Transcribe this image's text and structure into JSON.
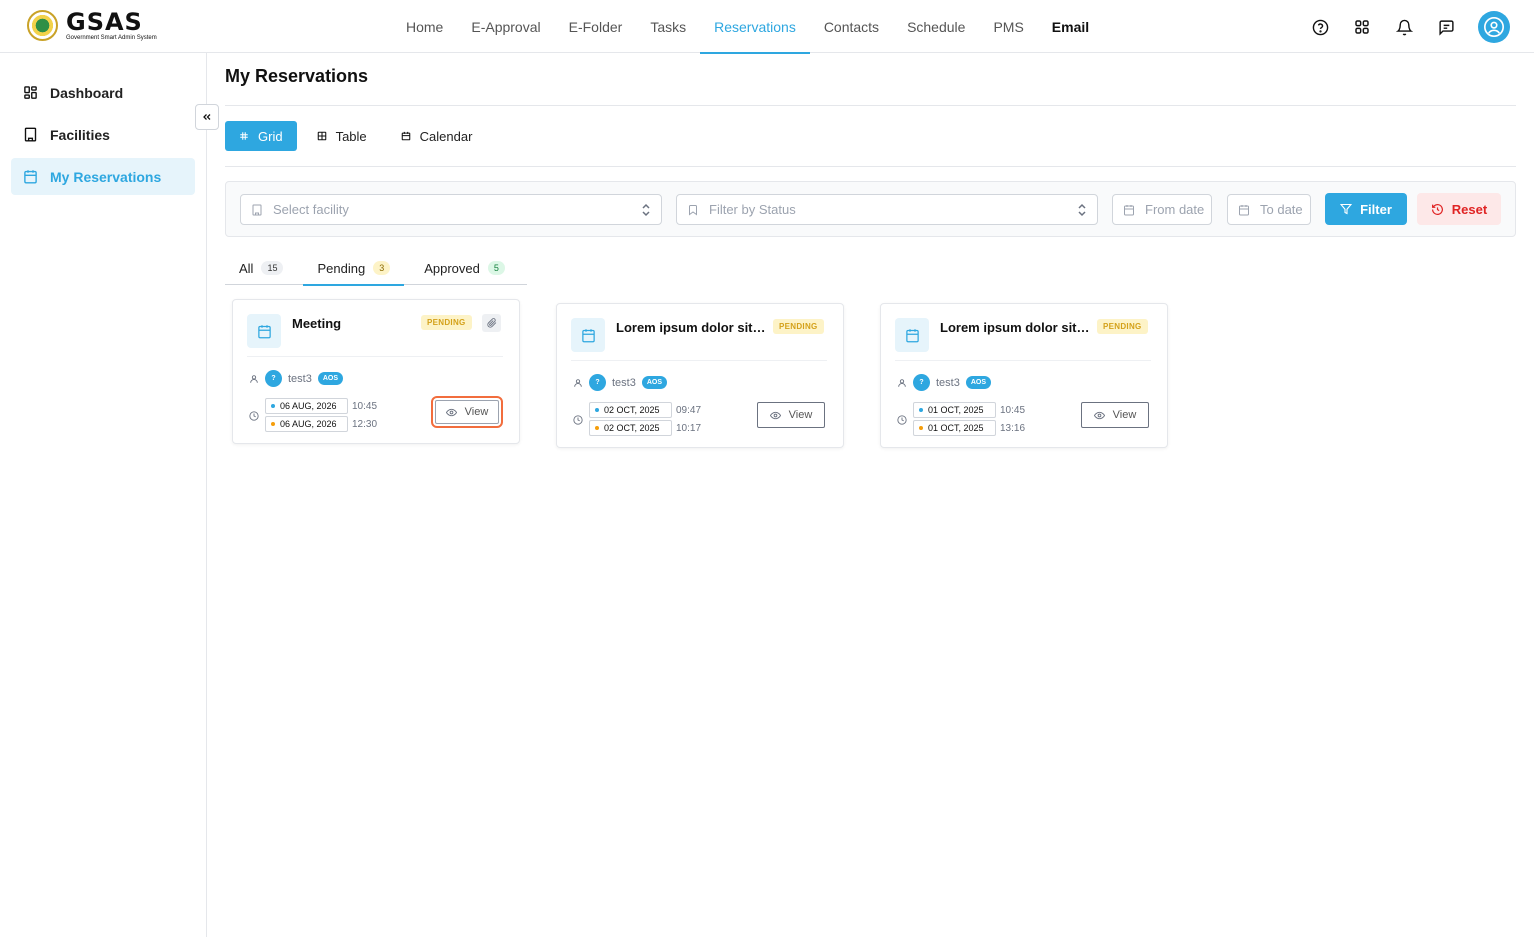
{
  "brand": {
    "name": "GSAS",
    "subtitle": "Government Smart Admin System"
  },
  "nav": {
    "items": [
      {
        "label": "Home"
      },
      {
        "label": "E-Approval"
      },
      {
        "label": "E-Folder"
      },
      {
        "label": "Tasks"
      },
      {
        "label": "Reservations",
        "active": true
      },
      {
        "label": "Contacts"
      },
      {
        "label": "Schedule"
      },
      {
        "label": "PMS"
      },
      {
        "label": "Email"
      }
    ]
  },
  "top_icons": [
    "help-circle-icon",
    "apps-grid-icon",
    "bell-icon",
    "message-icon",
    "user-avatar-icon"
  ],
  "sidebar": {
    "items": [
      {
        "label": "Dashboard",
        "icon": "dashboard-icon"
      },
      {
        "label": "Facilities",
        "icon": "building-icon"
      },
      {
        "label": "My Reservations",
        "icon": "calendar-icon",
        "active": true
      }
    ]
  },
  "page": {
    "title": "My Reservations",
    "view_tabs": [
      {
        "label": "Grid",
        "active": true
      },
      {
        "label": "Table"
      },
      {
        "label": "Calendar"
      }
    ]
  },
  "filters": {
    "facility_placeholder": "Select facility",
    "status_placeholder": "Filter by Status",
    "from_placeholder": "From date",
    "to_placeholder": "To date",
    "filter_label": "Filter",
    "reset_label": "Reset"
  },
  "status_tabs": [
    {
      "label": "All",
      "count": "15"
    },
    {
      "label": "Pending",
      "count": "3",
      "active": true
    },
    {
      "label": "Approved",
      "count": "5"
    }
  ],
  "cards": [
    {
      "title": "Meeting",
      "status": "PENDING",
      "has_attachment": true,
      "user_initial": "?",
      "user": "test3",
      "org": "AOS",
      "start_date": "06 AUG, 2026",
      "start_time": "10:45",
      "end_date": "06 AUG, 2026",
      "end_time": "12:30",
      "view_label": "View"
    },
    {
      "title": "Lorem ipsum dolor sit ...",
      "status": "PENDING",
      "user_initial": "?",
      "user": "test3",
      "org": "AOS",
      "start_date": "02 OCT, 2025",
      "start_time": "09:47",
      "end_date": "02 OCT, 2025",
      "end_time": "10:17",
      "view_label": "View"
    },
    {
      "title": "Lorem ipsum dolor sit ...",
      "status": "PENDING",
      "user_initial": "?",
      "user": "test3",
      "org": "AOS",
      "start_date": "01 OCT, 2025",
      "start_time": "10:45",
      "end_date": "01 OCT, 2025",
      "end_time": "13:16",
      "view_label": "View"
    }
  ],
  "colors": {
    "accent": "#2ea7e0",
    "danger": "#e02424",
    "pending": "#d4a11a",
    "highlight": "#f26d3d"
  }
}
